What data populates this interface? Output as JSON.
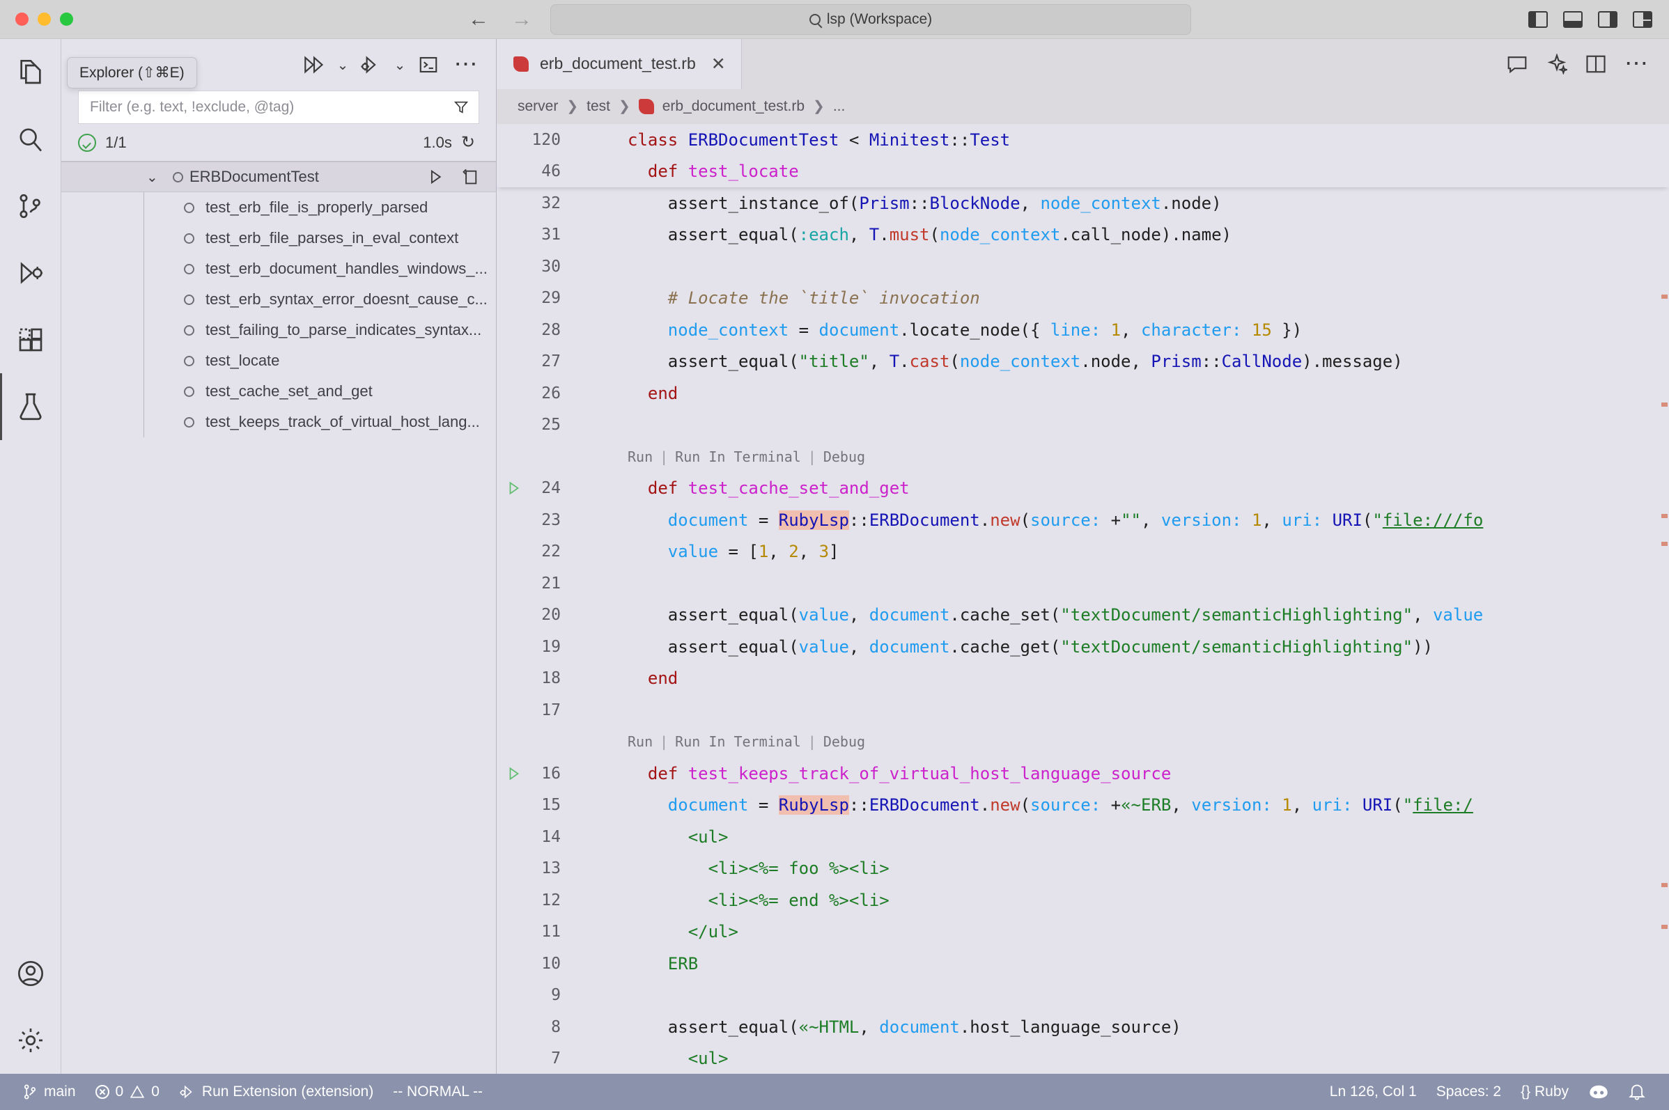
{
  "titlebar": {
    "command_center_text": "lsp (Workspace)",
    "search_icon": "search-icon",
    "back_icon": "arrow-left-icon",
    "forward_icon": "arrow-right-icon",
    "layout_icons": [
      "toggle-primary-sidebar-icon",
      "toggle-panel-icon",
      "toggle-secondary-sidebar-icon",
      "customize-layout-icon"
    ]
  },
  "activitybar": {
    "items": [
      {
        "name": "explorer",
        "icon": "files-icon",
        "active": false
      },
      {
        "name": "search",
        "icon": "search-icon",
        "active": false
      },
      {
        "name": "source-control",
        "icon": "source-control-icon",
        "active": false
      },
      {
        "name": "run-and-debug",
        "icon": "run-debug-icon",
        "active": false
      },
      {
        "name": "extensions",
        "icon": "extensions-icon",
        "active": false
      },
      {
        "name": "testing",
        "icon": "beaker-icon",
        "active": true
      }
    ],
    "bottom_items": [
      {
        "name": "accounts",
        "icon": "account-icon"
      },
      {
        "name": "manage",
        "icon": "gear-icon"
      }
    ]
  },
  "tooltip": {
    "text": "Explorer (⇧⌘E)"
  },
  "sidebar": {
    "toolbar": [
      {
        "name": "run-all-tests",
        "icon": "run-all-icon"
      },
      {
        "name": "run-all-tests-dropdown",
        "icon": "chevron-down-icon"
      },
      {
        "name": "debug-all-tests",
        "icon": "debug-all-icon"
      },
      {
        "name": "debug-all-tests-dropdown",
        "icon": "chevron-down-icon"
      },
      {
        "name": "show-output",
        "icon": "terminal-icon"
      },
      {
        "name": "more-actions",
        "icon": "ellipsis-icon"
      }
    ],
    "filter": {
      "placeholder": "Filter (e.g. text, !exclude, @tag)",
      "value": "",
      "filter_icon": "funnel-icon"
    },
    "status": {
      "passed_icon": "check-circle-icon",
      "count": "1/1",
      "duration": "1.0s",
      "refresh_icon": "refresh-icon"
    },
    "tree": {
      "root": {
        "label": "ERBDocumentTest",
        "chevron": "⌄",
        "run_icon": "run-icon",
        "peek_icon": "peek-output-icon"
      },
      "children": [
        {
          "label": "test_erb_file_is_properly_parsed"
        },
        {
          "label": "test_erb_file_parses_in_eval_context"
        },
        {
          "label": "test_erb_document_handles_windows_..."
        },
        {
          "label": "test_erb_syntax_error_doesnt_cause_c..."
        },
        {
          "label": "test_failing_to_parse_indicates_syntax..."
        },
        {
          "label": "test_locate"
        },
        {
          "label": "test_cache_set_and_get"
        },
        {
          "label": "test_keeps_track_of_virtual_host_lang..."
        }
      ]
    }
  },
  "editor": {
    "tab": {
      "label": "erb_document_test.rb",
      "icon": "ruby-file-icon",
      "close_icon": "close-icon"
    },
    "tab_actions": [
      {
        "name": "open-chat",
        "icon": "chat-icon"
      },
      {
        "name": "copilot-sparkle",
        "icon": "sparkle-icon"
      },
      {
        "name": "split-editor",
        "icon": "split-editor-icon"
      },
      {
        "name": "more-actions",
        "icon": "ellipsis-icon"
      }
    ],
    "breadcrumb": [
      "server",
      "test",
      "erb_document_test.rb",
      "..."
    ],
    "sticky_scroll": [
      {
        "num": "120",
        "tokens": [
          {
            "t": "class ",
            "c": "k"
          },
          {
            "t": "ERBDocumentTest",
            "c": "ty"
          },
          {
            "t": " < ",
            "c": "prop"
          },
          {
            "t": "Minitest",
            "c": "ty"
          },
          {
            "t": "::",
            "c": "prop"
          },
          {
            "t": "Test",
            "c": "ty"
          }
        ]
      },
      {
        "num": "46",
        "indent": 1,
        "tokens": [
          {
            "t": "  def ",
            "c": "k"
          },
          {
            "t": "test_locate",
            "c": "fn"
          }
        ]
      }
    ],
    "lines": [
      {
        "num": "32",
        "tokens": [
          {
            "t": "    assert_instance_of",
            "c": "prop"
          },
          {
            "t": "(",
            "c": "prop"
          },
          {
            "t": "Prism",
            "c": "ty"
          },
          {
            "t": "::",
            "c": "prop"
          },
          {
            "t": "BlockNode",
            "c": "ty"
          },
          {
            "t": ", ",
            "c": "prop"
          },
          {
            "t": "node_context",
            "c": "var"
          },
          {
            "t": ".node)",
            "c": "prop"
          }
        ]
      },
      {
        "num": "31",
        "tokens": [
          {
            "t": "    assert_equal(",
            "c": "prop"
          },
          {
            "t": ":each",
            "c": "sym"
          },
          {
            "t": ", ",
            "c": "prop"
          },
          {
            "t": "T",
            "c": "ty"
          },
          {
            "t": ".",
            "c": "prop"
          },
          {
            "t": "must",
            "c": "mth"
          },
          {
            "t": "(",
            "c": "prop"
          },
          {
            "t": "node_context",
            "c": "var"
          },
          {
            "t": ".call_node).name)",
            "c": "prop"
          }
        ]
      },
      {
        "num": "30",
        "tokens": []
      },
      {
        "num": "29",
        "tokens": [
          {
            "t": "    # Locate the `title` invocation",
            "c": "cmt"
          }
        ]
      },
      {
        "num": "28",
        "tokens": [
          {
            "t": "    ",
            "c": "prop"
          },
          {
            "t": "node_context",
            "c": "var"
          },
          {
            "t": " = ",
            "c": "prop"
          },
          {
            "t": "document",
            "c": "var"
          },
          {
            "t": ".locate_node({ ",
            "c": "prop"
          },
          {
            "t": "line:",
            "c": "var"
          },
          {
            "t": " ",
            "c": "prop"
          },
          {
            "t": "1",
            "c": "num"
          },
          {
            "t": ", ",
            "c": "prop"
          },
          {
            "t": "character:",
            "c": "var"
          },
          {
            "t": " ",
            "c": "prop"
          },
          {
            "t": "15",
            "c": "num"
          },
          {
            "t": " })",
            "c": "prop"
          }
        ]
      },
      {
        "num": "27",
        "tokens": [
          {
            "t": "    assert_equal(",
            "c": "prop"
          },
          {
            "t": "\"title\"",
            "c": "str"
          },
          {
            "t": ", ",
            "c": "prop"
          },
          {
            "t": "T",
            "c": "ty"
          },
          {
            "t": ".",
            "c": "prop"
          },
          {
            "t": "cast",
            "c": "mth"
          },
          {
            "t": "(",
            "c": "prop"
          },
          {
            "t": "node_context",
            "c": "var"
          },
          {
            "t": ".node, ",
            "c": "prop"
          },
          {
            "t": "Prism",
            "c": "ty"
          },
          {
            "t": "::",
            "c": "prop"
          },
          {
            "t": "CallNode",
            "c": "ty"
          },
          {
            "t": ").message)",
            "c": "prop"
          }
        ]
      },
      {
        "num": "26",
        "tokens": [
          {
            "t": "  end",
            "c": "k"
          }
        ]
      },
      {
        "num": "25",
        "tokens": []
      },
      {
        "codelens": true,
        "labels": [
          "Run",
          "Run In Terminal",
          "Debug"
        ]
      },
      {
        "num": "24",
        "has_play": true,
        "tokens": [
          {
            "t": "  def ",
            "c": "k"
          },
          {
            "t": "test_cache_set_and_get",
            "c": "fn"
          }
        ]
      },
      {
        "num": "23",
        "tokens": [
          {
            "t": "    ",
            "c": "prop"
          },
          {
            "t": "document",
            "c": "var"
          },
          {
            "t": " = ",
            "c": "prop"
          },
          {
            "t": "RubyLsp",
            "c": "ty hl"
          },
          {
            "t": "::",
            "c": "prop"
          },
          {
            "t": "ERBDocument",
            "c": "ty"
          },
          {
            "t": ".",
            "c": "prop"
          },
          {
            "t": "new",
            "c": "mth"
          },
          {
            "t": "(",
            "c": "prop"
          },
          {
            "t": "source:",
            "c": "var"
          },
          {
            "t": " +",
            "c": "prop"
          },
          {
            "t": "\"\"",
            "c": "str"
          },
          {
            "t": ", ",
            "c": "prop"
          },
          {
            "t": "version:",
            "c": "var"
          },
          {
            "t": " ",
            "c": "prop"
          },
          {
            "t": "1",
            "c": "num"
          },
          {
            "t": ", ",
            "c": "prop"
          },
          {
            "t": "uri:",
            "c": "var"
          },
          {
            "t": " ",
            "c": "prop"
          },
          {
            "t": "URI",
            "c": "ty"
          },
          {
            "t": "(",
            "c": "prop"
          },
          {
            "t": "\"",
            "c": "str"
          },
          {
            "t": "file:///fo",
            "c": "str ulink"
          }
        ]
      },
      {
        "num": "22",
        "tokens": [
          {
            "t": "    ",
            "c": "prop"
          },
          {
            "t": "value",
            "c": "var"
          },
          {
            "t": " = [",
            "c": "prop"
          },
          {
            "t": "1",
            "c": "num"
          },
          {
            "t": ", ",
            "c": "prop"
          },
          {
            "t": "2",
            "c": "num"
          },
          {
            "t": ", ",
            "c": "prop"
          },
          {
            "t": "3",
            "c": "num"
          },
          {
            "t": "]",
            "c": "prop"
          }
        ]
      },
      {
        "num": "21",
        "tokens": []
      },
      {
        "num": "20",
        "tokens": [
          {
            "t": "    assert_equal(",
            "c": "prop"
          },
          {
            "t": "value",
            "c": "var"
          },
          {
            "t": ", ",
            "c": "prop"
          },
          {
            "t": "document",
            "c": "var"
          },
          {
            "t": ".cache_set(",
            "c": "prop"
          },
          {
            "t": "\"textDocument/semanticHighlighting\"",
            "c": "str"
          },
          {
            "t": ", ",
            "c": "prop"
          },
          {
            "t": "value",
            "c": "var"
          }
        ]
      },
      {
        "num": "19",
        "tokens": [
          {
            "t": "    assert_equal(",
            "c": "prop"
          },
          {
            "t": "value",
            "c": "var"
          },
          {
            "t": ", ",
            "c": "prop"
          },
          {
            "t": "document",
            "c": "var"
          },
          {
            "t": ".cache_get(",
            "c": "prop"
          },
          {
            "t": "\"textDocument/semanticHighlighting\"",
            "c": "str"
          },
          {
            "t": "))",
            "c": "prop"
          }
        ]
      },
      {
        "num": "18",
        "tokens": [
          {
            "t": "  end",
            "c": "k"
          }
        ]
      },
      {
        "num": "17",
        "tokens": []
      },
      {
        "codelens": true,
        "labels": [
          "Run",
          "Run In Terminal",
          "Debug"
        ]
      },
      {
        "num": "16",
        "has_play": true,
        "tokens": [
          {
            "t": "  def ",
            "c": "k"
          },
          {
            "t": "test_keeps_track_of_virtual_host_language_source",
            "c": "fn"
          }
        ]
      },
      {
        "num": "15",
        "tokens": [
          {
            "t": "    ",
            "c": "prop"
          },
          {
            "t": "document",
            "c": "var"
          },
          {
            "t": " = ",
            "c": "prop"
          },
          {
            "t": "RubyLsp",
            "c": "ty hl"
          },
          {
            "t": "::",
            "c": "prop"
          },
          {
            "t": "ERBDocument",
            "c": "ty"
          },
          {
            "t": ".",
            "c": "prop"
          },
          {
            "t": "new",
            "c": "mth"
          },
          {
            "t": "(",
            "c": "prop"
          },
          {
            "t": "source:",
            "c": "var"
          },
          {
            "t": " +",
            "c": "prop"
          },
          {
            "t": "«~ERB",
            "c": "str"
          },
          {
            "t": ", ",
            "c": "prop"
          },
          {
            "t": "version:",
            "c": "var"
          },
          {
            "t": " ",
            "c": "prop"
          },
          {
            "t": "1",
            "c": "num"
          },
          {
            "t": ", ",
            "c": "prop"
          },
          {
            "t": "uri:",
            "c": "var"
          },
          {
            "t": " ",
            "c": "prop"
          },
          {
            "t": "URI",
            "c": "ty"
          },
          {
            "t": "(",
            "c": "prop"
          },
          {
            "t": "\"",
            "c": "str"
          },
          {
            "t": "file:/",
            "c": "str ulink"
          }
        ]
      },
      {
        "num": "14",
        "tokens": [
          {
            "t": "      <ul>",
            "c": "str"
          }
        ]
      },
      {
        "num": "13",
        "tokens": [
          {
            "t": "        <li><%= foo %><li>",
            "c": "str"
          }
        ]
      },
      {
        "num": "12",
        "tokens": [
          {
            "t": "        <li><%= end %><li>",
            "c": "str"
          }
        ]
      },
      {
        "num": "11",
        "tokens": [
          {
            "t": "      </ul>",
            "c": "str"
          }
        ]
      },
      {
        "num": "10",
        "tokens": [
          {
            "t": "    ERB",
            "c": "str"
          }
        ]
      },
      {
        "num": "9",
        "tokens": []
      },
      {
        "num": "8",
        "tokens": [
          {
            "t": "    assert_equal(",
            "c": "prop"
          },
          {
            "t": "«~HTML",
            "c": "str"
          },
          {
            "t": ", ",
            "c": "prop"
          },
          {
            "t": "document",
            "c": "var"
          },
          {
            "t": ".host_language_source)",
            "c": "prop"
          }
        ]
      },
      {
        "num": "7",
        "tokens": [
          {
            "t": "      <ul>",
            "c": "str"
          }
        ]
      }
    ]
  },
  "statusbar": {
    "left": [
      {
        "name": "branch",
        "icon": "source-control-icon",
        "label": "main"
      },
      {
        "name": "problems",
        "icon": "error-warning-icon",
        "label": "0  0",
        "errors": "0",
        "warnings": "0"
      },
      {
        "name": "debug-target",
        "icon": "debug-icon",
        "label": "Run Extension (extension)"
      },
      {
        "name": "vim-mode",
        "icon": "",
        "label": "-- NORMAL --"
      }
    ],
    "right": [
      {
        "name": "cursor-position",
        "label": "Ln 126, Col 1"
      },
      {
        "name": "indentation",
        "label": "Spaces: 2"
      },
      {
        "name": "language-mode",
        "label": "{} Ruby"
      },
      {
        "name": "copilot",
        "icon": "copilot-icon",
        "label": ""
      },
      {
        "name": "notifications",
        "icon": "bell-icon",
        "label": ""
      }
    ]
  },
  "colors": {
    "accent": "#8b92ac",
    "editor_bg": "#e4e2ea",
    "titlebar_bg": "#d4d4d4",
    "ruby_red": "#cc3a3a",
    "pass_green": "#3fa34d",
    "highlight": "#f0bfb0"
  }
}
